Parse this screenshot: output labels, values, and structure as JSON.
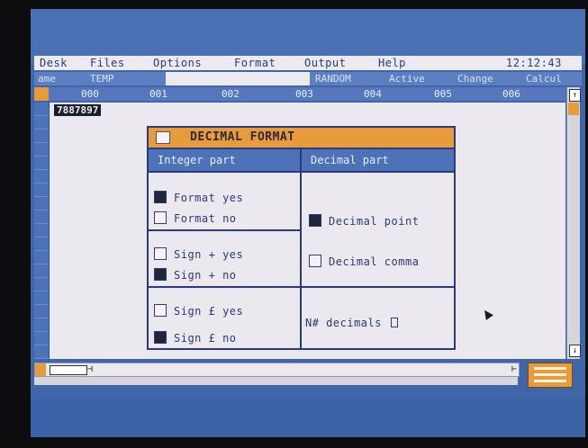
{
  "menubar": {
    "items": [
      "Desk",
      "Files",
      "Options",
      "Format",
      "Output",
      "Help"
    ],
    "clock": "12:12:43"
  },
  "namebar": {
    "name_label": "ame",
    "file_name": "TEMP",
    "mode": "RANDOM",
    "status": "Active",
    "change": "Change",
    "extra": "Calcul"
  },
  "columns": {
    "corner": "",
    "headers": [
      "000",
      "001",
      "002",
      "003",
      "004",
      "005",
      "006"
    ]
  },
  "sheet": {
    "cell_value": "7887897"
  },
  "dialog": {
    "title": "DECIMAL FORMAT",
    "integer_header": "Integer part",
    "decimal_header": "Decimal part",
    "integer_options": [
      {
        "label": "Format yes",
        "checked": true
      },
      {
        "label": "Format no",
        "checked": false
      },
      {
        "label": "Sign + yes",
        "checked": false
      },
      {
        "label": "Sign + no",
        "checked": true
      },
      {
        "label": "Sign £ yes",
        "checked": false
      },
      {
        "label": "Sign £ no",
        "checked": true
      }
    ],
    "decimal_options": [
      {
        "label": "Decimal point",
        "checked": true
      },
      {
        "label": "Decimal comma",
        "checked": false
      }
    ],
    "decimals_label": "N# decimals"
  },
  "colors": {
    "screen_blue": "#3f66a8",
    "accent_orange": "#e89b3a",
    "paper": "#ebe8ee",
    "ink": "#2a3a7a"
  }
}
